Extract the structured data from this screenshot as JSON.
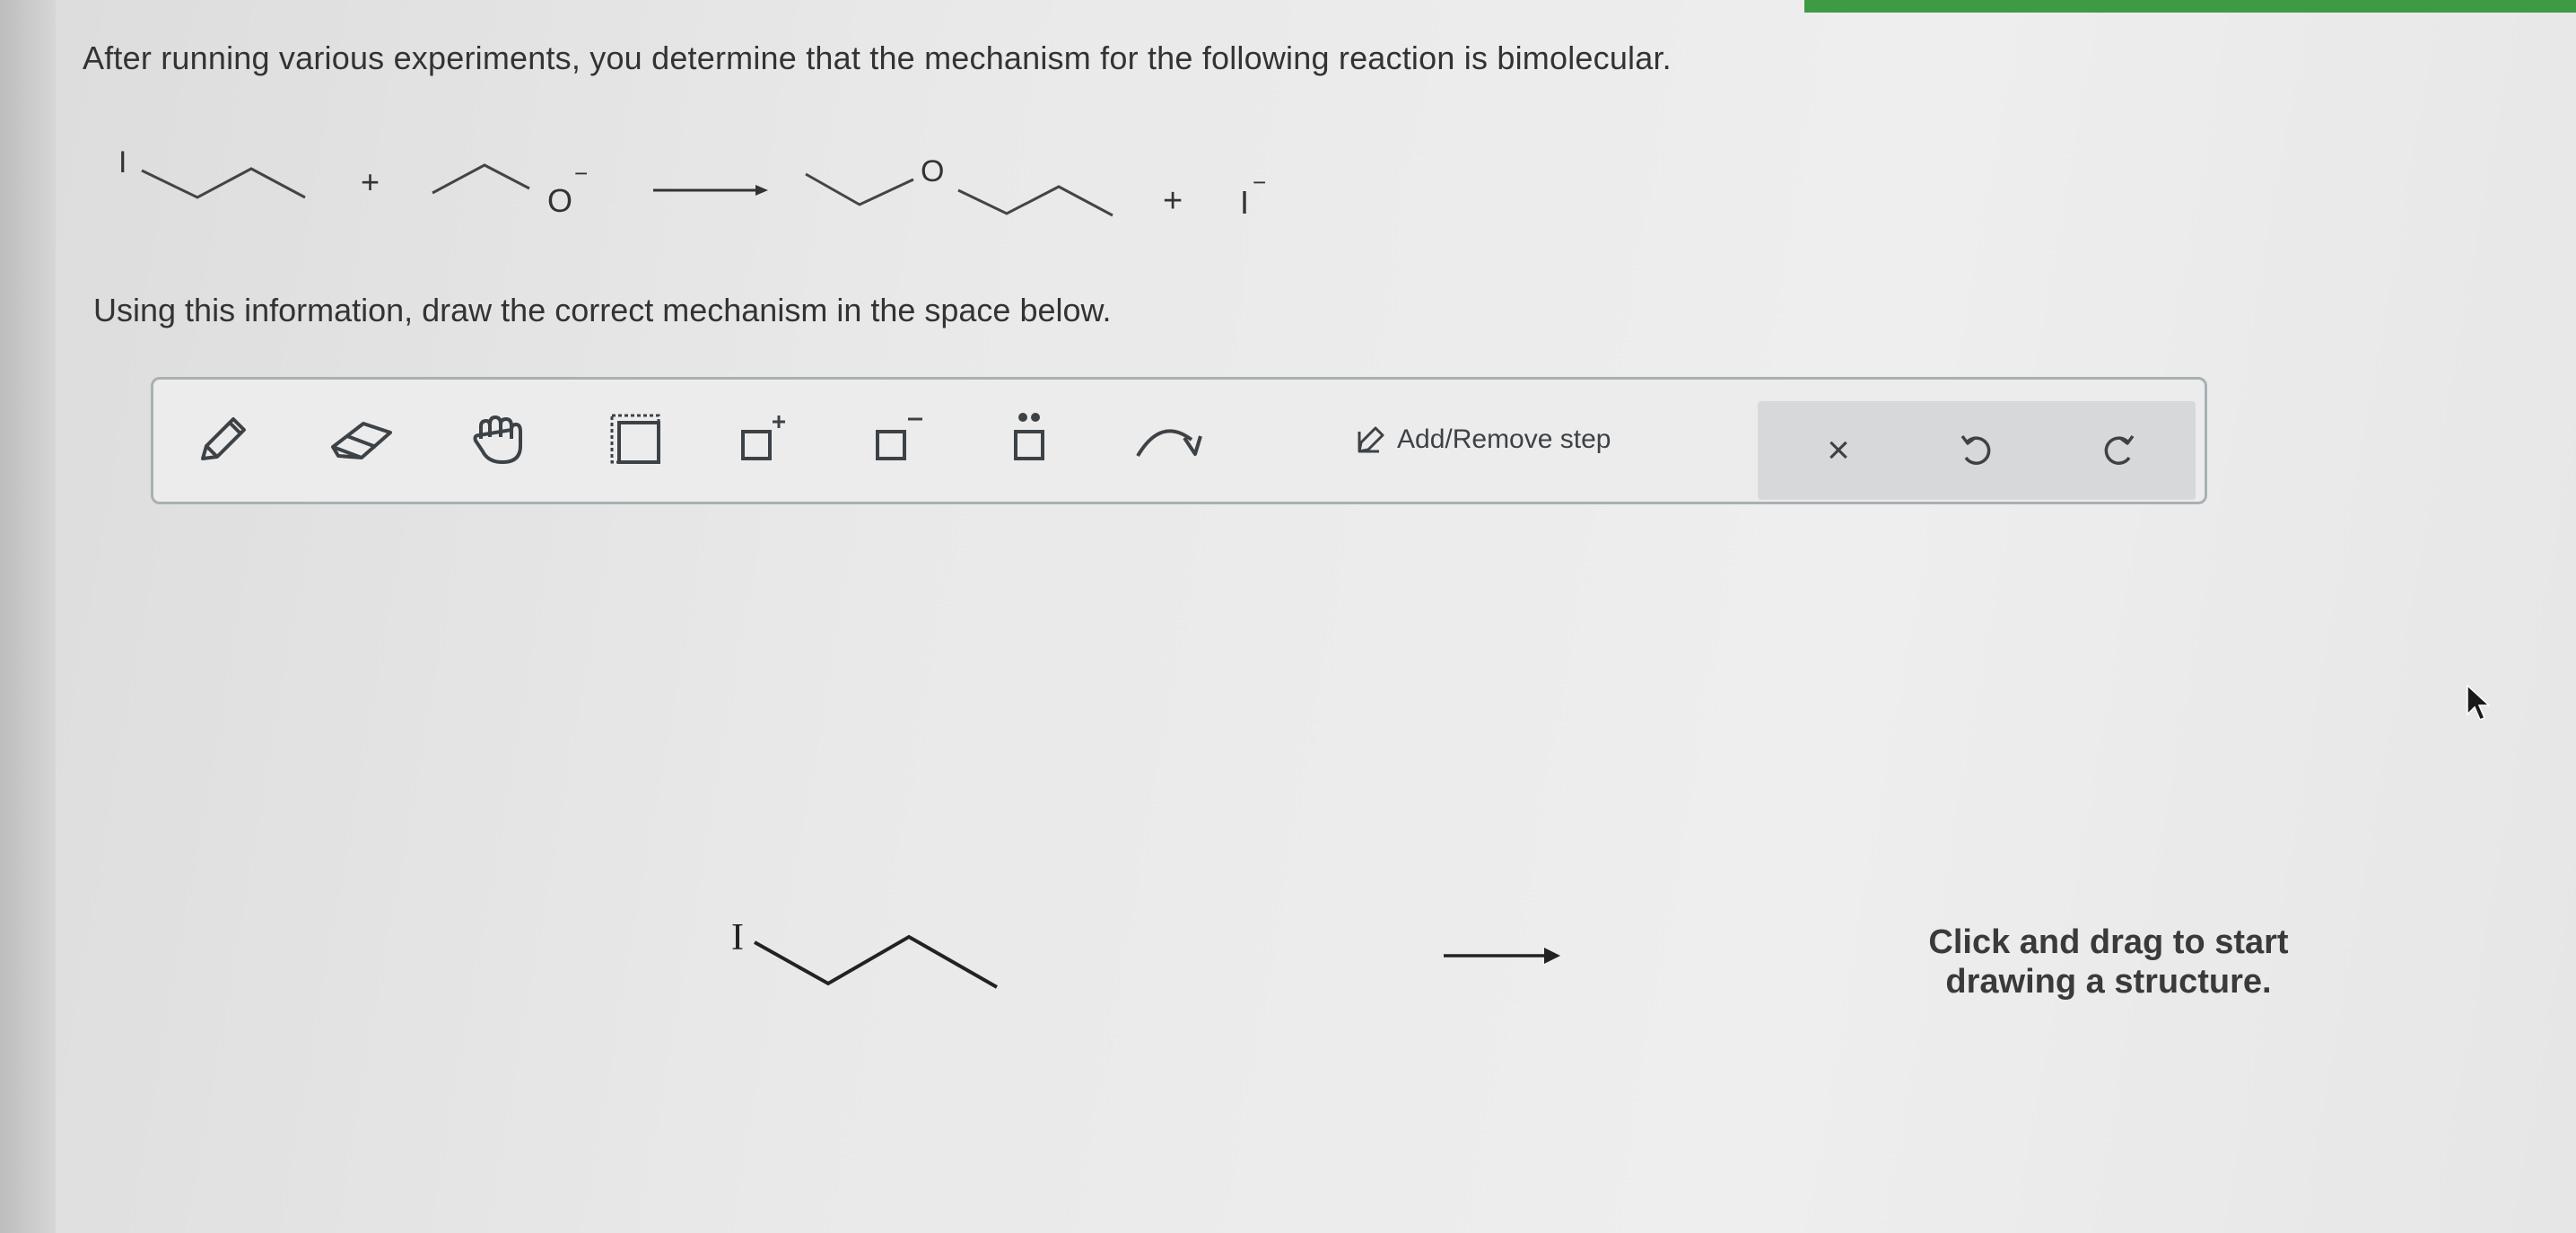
{
  "question": {
    "prompt": "After running various experiments, you determine that the mechanism for the following reaction is bimolecular.",
    "instruction": "Using this information, draw the correct mechanism in the space below."
  },
  "reaction": {
    "reactant1_atom": "I",
    "plus1": "+",
    "reactant2_atom": "O",
    "reactant2_charge": "−",
    "product_atom": "O",
    "plus2": "+",
    "byproduct": "I",
    "byproduct_charge": "−"
  },
  "toolbar": {
    "tools": [
      "pencil-icon",
      "eraser-icon",
      "hand-icon",
      "selection-icon",
      "positive-charge-icon",
      "negative-charge-icon",
      "lone-pair-icon",
      "curved-arrow-icon"
    ],
    "add_remove_step_label": "Add/Remove step",
    "clear_symbol": "×"
  },
  "canvas": {
    "starting_atom": "I",
    "hint_line1": "Click and drag to start",
    "hint_line2": "drawing a structure."
  },
  "colors": {
    "accent_green": "#3f9a45",
    "toolbar_border": "#a9b0b4",
    "icon": "#3d4246"
  }
}
